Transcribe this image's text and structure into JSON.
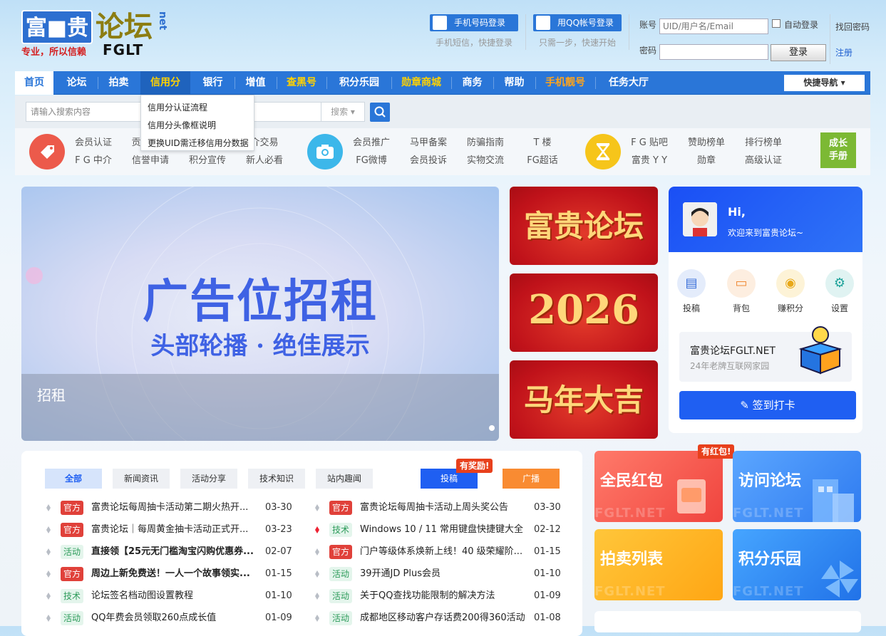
{
  "logo": {
    "box_text": "富■贵",
    "forum": "论坛",
    "net": "net",
    "slogan": "专业，所以信赖",
    "fglt": "FGLT"
  },
  "login": {
    "phone_btn": "手机号码登录",
    "phone_sub": "手机短信，快捷登录",
    "qq_btn": "用QQ帐号登录",
    "qq_sub": "只需一步，快速开始",
    "account_label": "账号",
    "account_placeholder": "UID/用户名/Email",
    "auto_login": "自动登录",
    "password_label": "密码",
    "login_btn": "登录",
    "find_password": "找回密码",
    "register": "注册"
  },
  "nav": {
    "items": [
      "首页",
      "论坛",
      "拍卖",
      "信用分",
      "银行",
      "增值",
      "查黑号",
      "积分乐园",
      "勋章商城",
      "商务",
      "帮助",
      "手机靓号",
      "任务大厅"
    ],
    "quick_nav": "快捷导航"
  },
  "search": {
    "placeholder": "请输入搜索内容",
    "select": "搜索"
  },
  "dropdown": [
    "信用分认证流程",
    "信用分头像框说明",
    "更换UID需迁移信用分数据"
  ],
  "quicklinks": {
    "group1": {
      "icon": "tag-icon",
      "row1": [
        "会员认证",
        "贡",
        "",
        "介交易"
      ],
      "row2": [
        "F G 中介",
        "信誉申请",
        "积分宣传",
        "新人必看"
      ]
    },
    "group2": {
      "icon": "camera-icon",
      "row1": [
        "会员推广",
        "马甲备案",
        "防骗指南",
        "T 楼"
      ],
      "row2": [
        "FG微博",
        "会员投诉",
        "实物交流",
        "FG超话"
      ]
    },
    "group3": {
      "icon": "hourglass-icon",
      "row1": [
        "F G 贴吧",
        "赞助榜单",
        "排行榜单"
      ],
      "row2": [
        "富贵 Y Y",
        "勋章",
        "高级认证"
      ]
    },
    "grow": [
      "成长",
      "手册"
    ]
  },
  "banner": {
    "title": "广告位招租",
    "subtitle": "头部轮播 · 绝佳展示",
    "caption": "招租"
  },
  "side_banners": [
    "富贵论坛",
    "2026",
    "马年大吉"
  ],
  "user": {
    "hi": "Hi,",
    "welcome": "欢迎来到富贵论坛~",
    "actions": [
      "投稿",
      "背包",
      "赚积分",
      "设置"
    ],
    "promo_title": "富贵论坛FGLT.NET",
    "promo_sub": "24年老牌互联网家园",
    "signin": "签到打卡"
  },
  "news": {
    "tabs": [
      "全部",
      "新闻资讯",
      "活动分享",
      "技术知识",
      "站内趣闻"
    ],
    "submit_btn": "投稿",
    "submit_badge": "有奖励!",
    "broadcast_btn": "广播",
    "left": [
      {
        "tag": "官方",
        "type": "off",
        "title": "富贵论坛每周抽卡活动第二期火热开...",
        "date": "03-30",
        "bold": false
      },
      {
        "tag": "官方",
        "type": "off",
        "title": "富贵论坛｜每周黄金抽卡活动正式开...",
        "date": "03-23",
        "bold": false
      },
      {
        "tag": "活动",
        "type": "act",
        "title": "直接领【25元无门槛淘宝闪购优惠券...",
        "date": "02-07",
        "bold": true
      },
      {
        "tag": "官方",
        "type": "off",
        "title": "周边上新免费送！一人一个故事领实...",
        "date": "01-15",
        "bold": true
      },
      {
        "tag": "技术",
        "type": "tech",
        "title": "论坛签名档动图设置教程",
        "date": "01-10",
        "bold": false
      },
      {
        "tag": "活动",
        "type": "act",
        "title": "QQ年费会员领取260点成长值",
        "date": "01-09",
        "bold": false
      }
    ],
    "right": [
      {
        "tag": "官方",
        "type": "off",
        "title": "富贵论坛每周抽卡活动上周头奖公告",
        "date": "03-30",
        "bold": false,
        "red": false
      },
      {
        "tag": "技术",
        "type": "tech",
        "title": "Windows 10 / 11 常用键盘快捷键大全",
        "date": "02-12",
        "bold": false,
        "red": true
      },
      {
        "tag": "官方",
        "type": "off",
        "title": "门户等级体系焕新上线！40 级荣耀阶...",
        "date": "01-15",
        "bold": false,
        "red": false
      },
      {
        "tag": "活动",
        "type": "act",
        "title": "39开通JD Plus会员",
        "date": "01-10",
        "bold": false,
        "red": false
      },
      {
        "tag": "活动",
        "type": "act",
        "title": "关于QQ查找功能限制的解决方法",
        "date": "01-09",
        "bold": false,
        "red": false
      },
      {
        "tag": "活动",
        "type": "act",
        "title": "成都地区移动客户存话费200得360活动",
        "date": "01-08",
        "bold": false,
        "red": false
      }
    ]
  },
  "tiles": {
    "t1": "全民红包",
    "t2": "访问论坛",
    "t3": "拍卖列表",
    "t4": "积分乐园",
    "badge": "有红包!",
    "watermark": "FGLT.NET"
  }
}
